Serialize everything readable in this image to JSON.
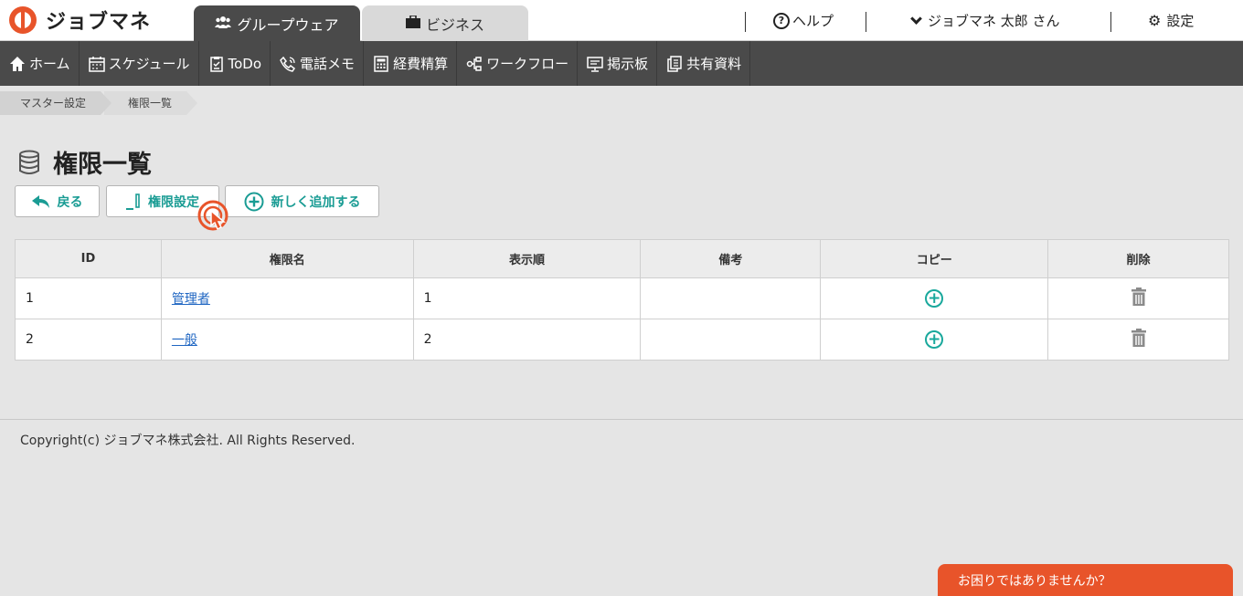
{
  "header": {
    "logo_text": "ジョブマネ",
    "tabs": [
      {
        "label": "グループウェア",
        "active": true
      },
      {
        "label": "ビジネス",
        "active": false
      }
    ],
    "help_label": "ヘルプ",
    "user_label": "ジョブマネ 太郎 さん",
    "settings_label": "設定"
  },
  "nav": [
    {
      "label": "ホーム",
      "icon": "home-icon"
    },
    {
      "label": "スケジュール",
      "icon": "calendar-icon"
    },
    {
      "label": "ToDo",
      "icon": "checklist-icon"
    },
    {
      "label": "電話メモ",
      "icon": "phone-icon"
    },
    {
      "label": "経費精算",
      "icon": "calculator-icon"
    },
    {
      "label": "ワークフロー",
      "icon": "workflow-icon"
    },
    {
      "label": "掲示板",
      "icon": "board-icon"
    },
    {
      "label": "共有資料",
      "icon": "documents-icon"
    }
  ],
  "breadcrumb": [
    "マスター設定",
    "権限一覧"
  ],
  "page_title": "権限一覧",
  "buttons": {
    "back": "戻る",
    "permission_settings": "権限設定",
    "add_new": "新しく追加する"
  },
  "table": {
    "headers": [
      "ID",
      "権限名",
      "表示順",
      "備考",
      "コピー",
      "削除"
    ],
    "rows": [
      {
        "id": "1",
        "name": "管理者",
        "order": "1",
        "note": ""
      },
      {
        "id": "2",
        "name": "一般",
        "order": "2",
        "note": ""
      }
    ]
  },
  "footer": "Copyright(c) ジョブマネ株式会社. All Rights Reserved.",
  "help_widget": "お困りではありませんか？",
  "colors": {
    "accent": "#1a9c94",
    "brand": "#e8542a",
    "nav_bg": "#4a4a4a",
    "link": "#1f66c2"
  }
}
